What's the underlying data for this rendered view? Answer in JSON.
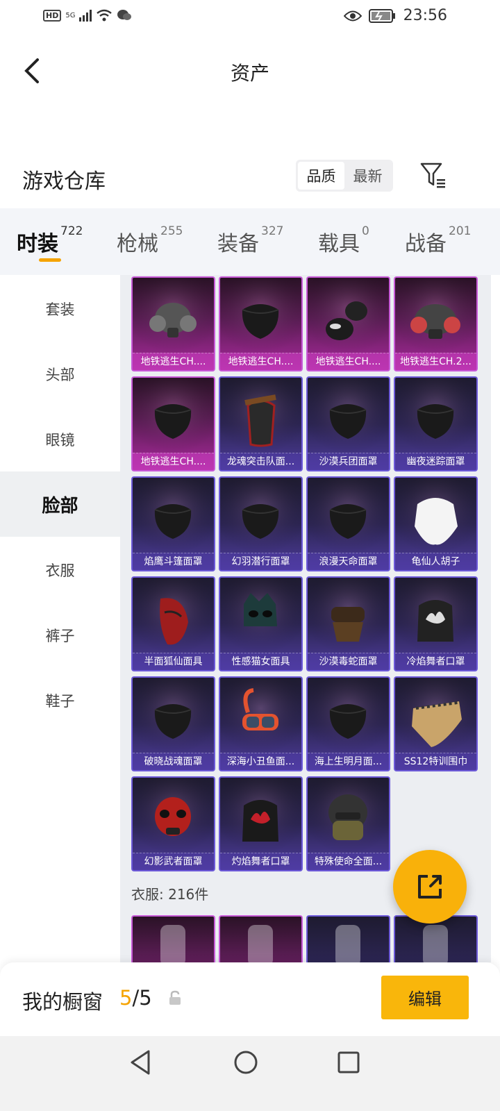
{
  "status_bar": {
    "time": "23:56",
    "hd": "HD",
    "network": "5G"
  },
  "header": {
    "title": "资产"
  },
  "warehouse": {
    "title": "游戏仓库",
    "sort_options": [
      "品质",
      "最新"
    ],
    "active_sort": "品质"
  },
  "tabs": [
    {
      "label": "时装",
      "count": "722"
    },
    {
      "label": "枪械",
      "count": "255"
    },
    {
      "label": "装备",
      "count": "327"
    },
    {
      "label": "载具",
      "count": "0"
    },
    {
      "label": "战备",
      "count": "201"
    }
  ],
  "side_nav": [
    "套装",
    "头部",
    "眼镜",
    "脸部",
    "衣服",
    "裤子",
    "鞋子"
  ],
  "items": [
    {
      "name": "地铁逃生CH....",
      "rarity": "pink",
      "icon": "gas-mask-icon"
    },
    {
      "name": "地铁逃生CH....",
      "rarity": "pink",
      "icon": "black-mask-icon"
    },
    {
      "name": "地铁逃生CH....",
      "rarity": "pink",
      "icon": "neck-gaiter-icon"
    },
    {
      "name": "地铁逃生CH.2...",
      "rarity": "pink",
      "icon": "respirator-icon"
    },
    {
      "name": "地铁逃生CH....",
      "rarity": "pink",
      "icon": "studded-mask-icon"
    },
    {
      "name": "龙魂突击队面...",
      "rarity": "purple",
      "icon": "warrior-mask-icon"
    },
    {
      "name": "沙漠兵团面罩",
      "rarity": "purple",
      "icon": "desert-mask-icon"
    },
    {
      "name": "幽夜迷踪面罩",
      "rarity": "purple",
      "icon": "night-mask-icon"
    },
    {
      "name": "焰鹰斗篷面罩",
      "rarity": "purple",
      "icon": "flame-hawk-mask-icon"
    },
    {
      "name": "幻羽潜行面罩",
      "rarity": "purple",
      "icon": "stealth-mask-icon"
    },
    {
      "name": "浪漫天命面罩",
      "rarity": "purple",
      "icon": "romantic-mask-icon"
    },
    {
      "name": "龟仙人胡子",
      "rarity": "purple",
      "icon": "beard-icon"
    },
    {
      "name": "半面狐仙面具",
      "rarity": "purple",
      "icon": "fox-mask-icon"
    },
    {
      "name": "性感猫女面具",
      "rarity": "purple",
      "icon": "cat-mask-icon"
    },
    {
      "name": "沙漠毒蛇面罩",
      "rarity": "purple",
      "icon": "goggle-mask-icon"
    },
    {
      "name": "冷焰舞者口罩",
      "rarity": "purple",
      "icon": "cold-flame-mask-icon"
    },
    {
      "name": "破晓战魂面罩",
      "rarity": "purple",
      "icon": "dawn-mask-icon"
    },
    {
      "name": "深海小丑鱼面...",
      "rarity": "purple",
      "icon": "snorkel-icon"
    },
    {
      "name": "海上生明月面...",
      "rarity": "purple",
      "icon": "sea-moon-mask-icon"
    },
    {
      "name": "SS12特训围巾",
      "rarity": "purple",
      "icon": "scarf-icon"
    },
    {
      "name": "幻影武者面罩",
      "rarity": "purple",
      "icon": "phantom-mask-icon"
    },
    {
      "name": "灼焰舞者口罩",
      "rarity": "purple",
      "icon": "flame-mask-icon"
    },
    {
      "name": "特殊使命全面...",
      "rarity": "purple",
      "icon": "helmet-icon"
    }
  ],
  "clothes_section": {
    "label": "衣服: 216件"
  },
  "clothes_preview": [
    {
      "rarity": "pink",
      "icon": "pink-dress-icon"
    },
    {
      "rarity": "pink",
      "icon": "cream-dress-icon"
    },
    {
      "rarity": "purple",
      "icon": "purple-outfit-icon"
    },
    {
      "rarity": "purple",
      "icon": "green-outfit-icon"
    }
  ],
  "showcase": {
    "label": "我的橱窗",
    "current": "5",
    "separator": "/",
    "total": "5",
    "edit_label": "编辑"
  },
  "colors": {
    "accent": "#f9b10a",
    "pink_rarity": "#c85ad8",
    "purple_rarity": "#6d5ad9"
  }
}
